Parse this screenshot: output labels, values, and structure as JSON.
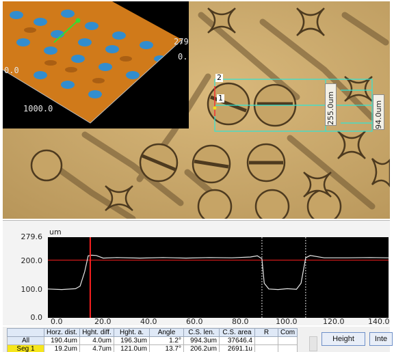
{
  "inset3d": {
    "label_left": "0.0",
    "label_bottom": "1000.0",
    "label_right_top": "279",
    "label_right_bottom": "0."
  },
  "micrograph": {
    "marker_2": "2",
    "marker_1": "1",
    "dim_horizontal": "255.0um",
    "dim_vertical": "94.0um"
  },
  "profile": {
    "unit": "um",
    "y_ticks": [
      "279.6",
      "200.0",
      "100.0",
      "0.0"
    ],
    "x_ticks": [
      "0.0",
      "20.0",
      "40.0",
      "60.0",
      "80.0",
      "100.0",
      "120.0",
      "140.0"
    ],
    "colors": {
      "background": "#000000",
      "profile_line": "#e8e8e8",
      "cursor": "#ff2020",
      "reference_line": "#ff2020",
      "guide_line": "#e0e0e0"
    }
  },
  "table": {
    "headers": [
      "",
      "Horz. dist.",
      "Hght. diff.",
      "Hght. a.",
      "Angle",
      "C.S. len.",
      "C.S. area",
      "R",
      "Com"
    ],
    "rows": [
      [
        "All",
        "190.4um",
        "4.0um",
        "196.3um",
        "1.2°",
        "994.3um",
        "37646.4",
        "",
        ""
      ],
      [
        "Seg 1",
        "19.2um",
        "4.7um",
        "121.0um",
        "13.7°",
        "206.2um",
        "2691.1u",
        "",
        ""
      ]
    ]
  },
  "buttons": {
    "height": "Height",
    "inte": "Inte"
  }
}
